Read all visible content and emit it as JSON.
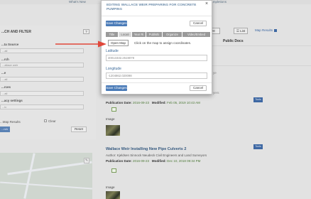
{
  "background": {
    "top_links": {
      "whats_new": "What's New",
      "completions": "...mpletions"
    },
    "search_panel": {
      "title": "...CH AND FILTER",
      "help_label": "?",
      "labels": [
        "...ta Source",
        "...rch",
        "...e",
        "...rces",
        "...acy settings"
      ],
      "fields": [
        "...all",
        "...allace weir",
        "...all",
        "...all",
        "...ic"
      ],
      "map_results_label": "...Map Results",
      "clear_label": "Clear",
      "search_button": "...rch",
      "reset_button": "Reset"
    },
    "results_header": {
      "mail_button": "✉",
      "list_button": "☰ List",
      "map_results_label": "Map Results",
      "public_docs_label": "Public Docs"
    },
    "fragments": [
      "yers",
      "ye"
    ],
    "tools_label": "Tools",
    "results": [
      {
        "publication_label": "Publication Date:",
        "publication_date": "2016-09-23",
        "modified_label": "Modified:",
        "modified_date": "Feb 05, 2019 10:43 AM",
        "image_label": "Image"
      },
      {
        "title": "Wallace Weir Installing New Pipe Culverts 2",
        "author": "Author: Kjeldsen Sinnock Neudeck Civil Engineers and Land Surveyors",
        "publication_label": "Publication Date:",
        "publication_date": "2016-09-23",
        "modified_label": "Modified:",
        "modified_date": "Dec 10, 2018 09:34 PM",
        "image_label": "Image"
      }
    ]
  },
  "modal": {
    "title": "EDITING WALLACE WEIR PREPARING FOR CONCRETE PUMPING",
    "close_icon": "×",
    "save_changes": "Save Changes",
    "cancel": "Cancel",
    "tabs": [
      {
        "label": "Title",
        "active": false
      },
      {
        "label": "Locati",
        "active": true
      },
      {
        "label": "Year Ri",
        "active": false
      },
      {
        "label": "Publishi",
        "active": false
      },
      {
        "label": "Organize",
        "active": false
      },
      {
        "label": "Video/Embed",
        "active": false
      }
    ],
    "open_map_button": "Open Map",
    "open_map_hint": "Click on the map to assign coordinates.",
    "latitude_label": "Latitude",
    "latitude_value": "40013332.2519078",
    "longitude_label": "Longitude",
    "longitude_value": "-1204862.020098"
  },
  "colors": {
    "primary_button": "#4a7bb8",
    "title_text": "#6a8aa9",
    "field_label": "#3c6a9a",
    "annotation_arrow": "#e0473a"
  }
}
